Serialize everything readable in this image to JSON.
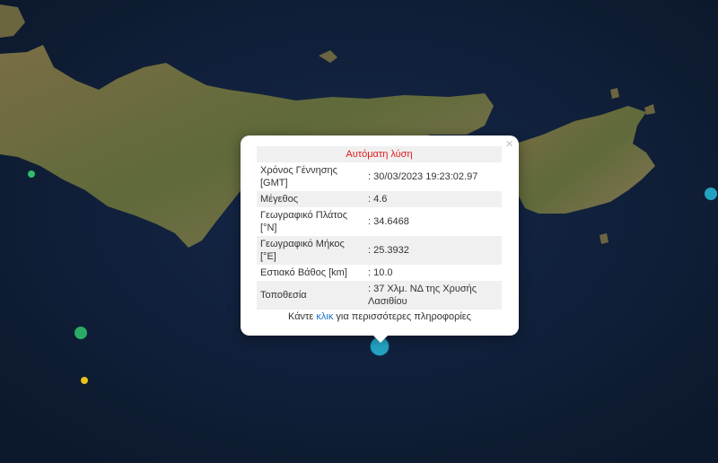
{
  "popup": {
    "title": "Αυτόματη λύση",
    "close": "×",
    "rows": [
      {
        "label": "Χρόνος Γέννησης [GMT]",
        "value": ": 30/03/2023 19:23:02.97"
      },
      {
        "label": "Μέγεθος",
        "value": ": 4.6"
      },
      {
        "label": "Γεωγραφικό Πλάτος [°N]",
        "value": ": 34.6468"
      },
      {
        "label": "Γεωγραφικό Μήκος [°E]",
        "value": ": 25.3932"
      },
      {
        "label": "Εστιακό Βάθος [km]",
        "value": ": 10.0"
      },
      {
        "label": "Τοποθεσία",
        "value": ": 37 Χλμ. ΝΔ της Χρυσής Λασιθίου"
      }
    ],
    "footer_pre": "Κάντε ",
    "footer_link": "κλικ",
    "footer_post": " για περισσότερες πληροφορίες"
  },
  "markers": [
    {
      "name": "main-event",
      "color": "#27b8d8"
    },
    {
      "name": "east-event",
      "color": "#27b8d8"
    },
    {
      "name": "west-event-small",
      "color": "#2ebd6b"
    },
    {
      "name": "southwest-event",
      "color": "#2ebd6b"
    },
    {
      "name": "southwest-event-yellow",
      "color": "#e8c21a"
    }
  ],
  "colors": {
    "sea": "#0f1e33",
    "land": "#6f6a3e",
    "highlight": "#e01b1b",
    "link": "#1a73c9"
  }
}
